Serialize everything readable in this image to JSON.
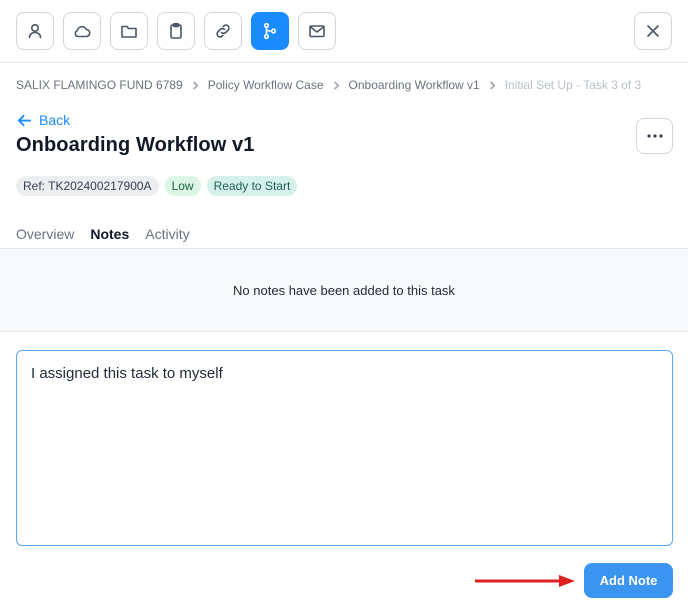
{
  "toolbar": {
    "buttons": [
      {
        "icon": "user-icon"
      },
      {
        "icon": "cloud-icon"
      },
      {
        "icon": "folder-icon"
      },
      {
        "icon": "clipboard-icon"
      },
      {
        "icon": "link-icon"
      },
      {
        "icon": "workflow-branch-icon",
        "active": true
      },
      {
        "icon": "mail-icon"
      }
    ],
    "close_icon": "close-icon",
    "active_color": "#1a8cff"
  },
  "breadcrumb": {
    "items": [
      "SALIX FLAMINGO FUND 6789",
      "Policy Workflow Case",
      "Onboarding Workflow v1",
      "Initial Set Up - Task 3 of 3"
    ]
  },
  "header": {
    "back_label": "Back",
    "title": "Onboarding Workflow v1",
    "more_icon": "ellipsis-icon"
  },
  "badges": {
    "ref": "Ref: TK202400217900A",
    "priority": "Low",
    "status": "Ready to Start"
  },
  "tabs": {
    "items": [
      "Overview",
      "Notes",
      "Activity"
    ],
    "active": "Notes",
    "underline_color": "#d97706"
  },
  "notes": {
    "empty_message": "No notes have been added to this task",
    "input_value": "I assigned this task to myself",
    "add_button_label": "Add Note",
    "button_color": "#3b95f0",
    "annotation_arrow_color": "#e02020"
  }
}
